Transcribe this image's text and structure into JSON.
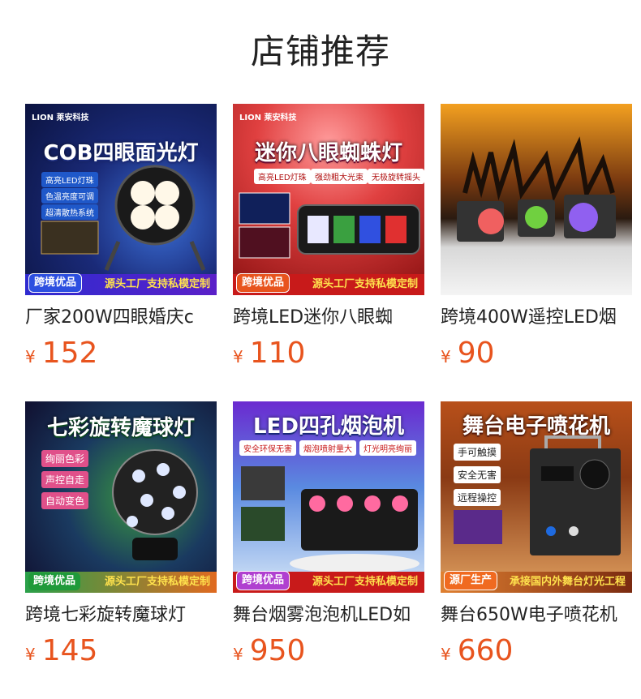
{
  "page": {
    "title": "店铺推荐"
  },
  "products": [
    {
      "name": "厂家200W四眼婚庆c",
      "currency": "¥",
      "price": "152",
      "banner": {
        "logo": "LION 莱安科技",
        "headline": "COB四眼面光灯",
        "chips": [
          "高亮LED灯珠",
          "色温亮度可调",
          "超清散热系统"
        ],
        "tag": "跨境优品",
        "slogan": "源头工厂支持私模定制"
      }
    },
    {
      "name": "跨境LED迷你八眼蜘",
      "currency": "¥",
      "price": "110",
      "banner": {
        "logo": "LION 莱安科技",
        "headline": "迷你八眼蜘蛛灯",
        "chips": [
          "高亮LED灯珠",
          "强劲粗大光束",
          "无极旋转摇头"
        ],
        "tag": "跨境优品",
        "slogan": "源头工厂支持私模定制"
      }
    },
    {
      "name": "跨境400W遥控LED烟",
      "currency": "¥",
      "price": "90",
      "banner": {
        "logo": "",
        "headline": "",
        "chips": [],
        "tag": "",
        "slogan": ""
      }
    },
    {
      "name": "跨境七彩旋转魔球灯",
      "currency": "¥",
      "price": "145",
      "banner": {
        "logo": "",
        "headline": "七彩旋转魔球灯",
        "chips": [
          "绚丽色彩",
          "声控自走",
          "自动变色"
        ],
        "tag": "跨境优品",
        "slogan": "源头工厂支持私模定制"
      }
    },
    {
      "name": "舞台烟雾泡泡机LED如",
      "currency": "¥",
      "price": "950",
      "banner": {
        "logo": "",
        "headline": "LED四孔烟泡机",
        "chips": [
          "安全环保无害",
          "烟泡喷射量大",
          "灯光明亮绚丽"
        ],
        "tag": "跨境优品",
        "slogan": "源头工厂支持私模定制"
      }
    },
    {
      "name": "舞台650W电子喷花机",
      "currency": "¥",
      "price": "660",
      "banner": {
        "logo": "",
        "headline": "舞台电子喷花机",
        "chips": [
          "手可触摸",
          "安全无害",
          "远程操控"
        ],
        "tag": "源厂生产",
        "slogan": "承接国内外舞台灯光工程"
      }
    }
  ],
  "colors": {
    "price": "#e8541e",
    "text": "#222222"
  }
}
